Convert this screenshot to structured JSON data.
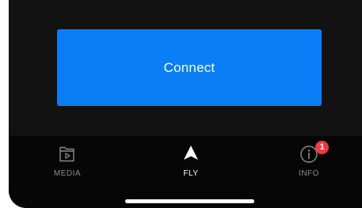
{
  "main": {
    "connect_label": "Connect"
  },
  "tabbar": {
    "tabs": [
      {
        "label": "MEDIA",
        "icon": "media-folder-icon",
        "active": false
      },
      {
        "label": "FLY",
        "icon": "fly-arrow-icon",
        "active": true
      },
      {
        "label": "INFO",
        "icon": "info-icon",
        "active": false,
        "badge": "1"
      }
    ]
  },
  "colors": {
    "background": "#121212",
    "tabbar": "#060606",
    "accent": "#0a7ff5",
    "badge": "#f03a3f",
    "inactive_label": "#8a8a8a"
  }
}
